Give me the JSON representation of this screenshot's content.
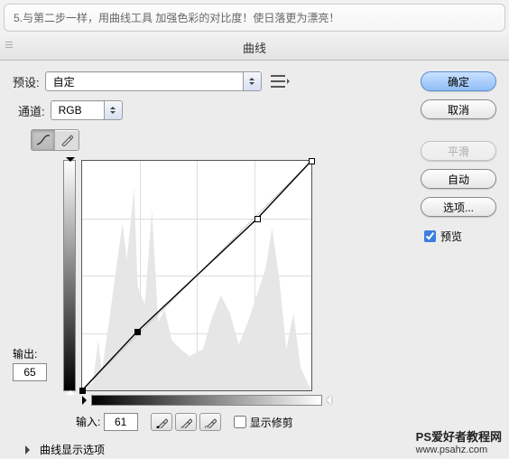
{
  "annotation": "5.与第二步一样，用曲线工具 加强色彩的对比度！使日落更为漂亮！",
  "title": "曲线",
  "preset": {
    "label": "预设:",
    "value": "自定"
  },
  "channel": {
    "label": "通道:",
    "value": "RGB"
  },
  "output": {
    "label": "输出:",
    "value": "65"
  },
  "input": {
    "label": "输入:",
    "value": "61"
  },
  "show_clip": {
    "label": "显示修剪",
    "checked": false
  },
  "options_toggle": "曲线显示选项",
  "buttons": {
    "ok": "确定",
    "cancel": "取消",
    "smooth": "平滑",
    "auto": "自动",
    "options": "选项..."
  },
  "preview": {
    "label": "预览",
    "checked": true
  },
  "watermark": {
    "line1": "PS爱好者教程网",
    "line2": "www.psahz.com"
  },
  "chart_data": {
    "type": "line",
    "title": "曲线",
    "xlabel": "输入",
    "ylabel": "输出",
    "xlim": [
      0,
      255
    ],
    "ylim": [
      0,
      255
    ],
    "points": [
      {
        "x": 0,
        "y": 0
      },
      {
        "x": 61,
        "y": 65
      },
      {
        "x": 195,
        "y": 190
      },
      {
        "x": 255,
        "y": 255
      }
    ],
    "grid": true
  }
}
